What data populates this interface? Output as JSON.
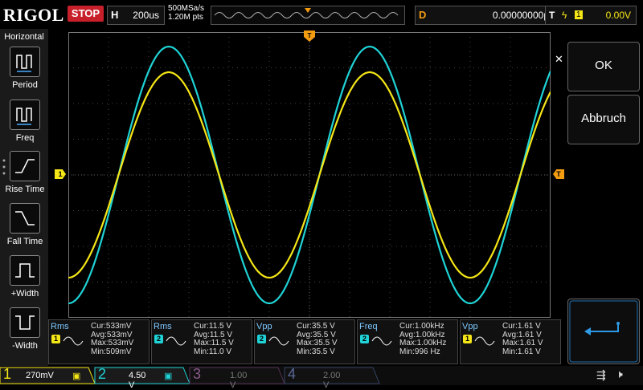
{
  "brand": "RIGOL",
  "run_state": "STOP",
  "horizontal": {
    "label": "H",
    "timebase": "200us",
    "sample_rate": "500MSa/s",
    "points": "1.20M pts"
  },
  "delay": {
    "label": "D",
    "value": "0.00000000ps"
  },
  "trigger": {
    "label": "T",
    "source": "1",
    "level": "0.00V"
  },
  "left_menu": {
    "title": "Horizontal",
    "items": [
      "Period",
      "Freq",
      "Rise Time",
      "Fall Time",
      "+Width",
      "-Width"
    ]
  },
  "softkeys": {
    "ok": "OK",
    "cancel": "Abbruch"
  },
  "measurements": [
    {
      "name": "Rms",
      "channel": "1",
      "cur": "Cur:533mV",
      "avg": "Avg:533mV",
      "max": "Max:533mV",
      "min": "Min:509mV"
    },
    {
      "name": "Rms",
      "channel": "2",
      "cur": "Cur:11.5 V",
      "avg": "Avg:11.5 V",
      "max": "Max:11.5 V",
      "min": "Min:11.0 V"
    },
    {
      "name": "Vpp",
      "channel": "2",
      "cur": "Cur:35.5 V",
      "avg": "Avg:35.5 V",
      "max": "Max:35.5 V",
      "min": "Min:35.5 V"
    },
    {
      "name": "Freq",
      "channel": "2",
      "cur": "Cur:1.00kHz",
      "avg": "Avg:1.00kHz",
      "max": "Max:1.00kHz",
      "min": "Min:996 Hz"
    },
    {
      "name": "Vpp",
      "channel": "1",
      "cur": "Cur:1.61 V",
      "avg": "Avg:1.61 V",
      "max": "Max:1.61 V",
      "min": "Min:1.61 V"
    }
  ],
  "channels": [
    {
      "num": "1",
      "scale": "270mV",
      "color": "#f5e617"
    },
    {
      "num": "2",
      "scale": "4.50 V",
      "color": "#1fd3d6"
    },
    {
      "num": "3",
      "scale": "1.00 V",
      "color": "#6a4a6a"
    },
    {
      "num": "4",
      "scale": "2.00 V",
      "color": "#4a5a7a"
    }
  ],
  "colors": {
    "ch1": "#f5e617",
    "ch2": "#1fd3d6",
    "trigger": "#f39c12",
    "stop": "#c8202a"
  },
  "markers": {
    "ch1_marker": "1",
    "trigger_marker": "T"
  }
}
